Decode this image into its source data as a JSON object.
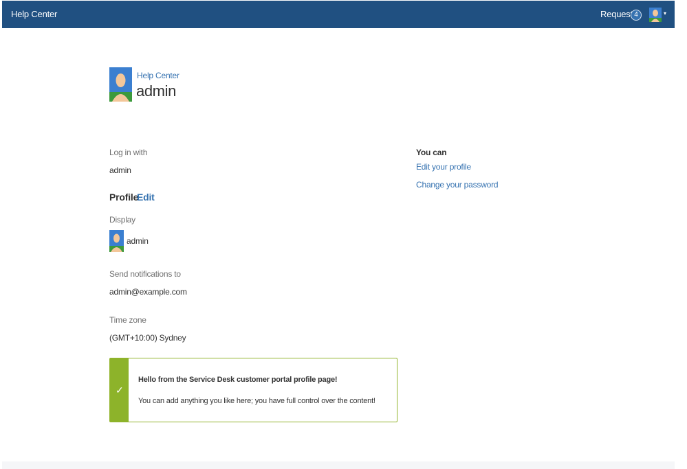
{
  "header": {
    "brand": "Help Center",
    "requests_label": "Requests",
    "requests_count": "4",
    "caret": "▾"
  },
  "breadcrumb": "Help Center",
  "page_title": "admin",
  "login": {
    "label": "Log in with",
    "value": "admin"
  },
  "profile": {
    "heading": "Profile",
    "edit_label": "Edit",
    "display_label": "Display",
    "display_name": "admin",
    "notify_label": "Send notifications to",
    "notify_value": "admin@example.com",
    "timezone_label": "Time zone",
    "timezone_value": "(GMT+10:00) Sydney"
  },
  "side": {
    "heading": "You can",
    "links": [
      "Edit your profile",
      "Change your password"
    ]
  },
  "message": {
    "icon": "✓",
    "title": "Hello from the Service Desk customer portal profile page!",
    "body": "You can add anything you like here; you have full control over the content!"
  },
  "colors": {
    "header_bg": "#205081",
    "link": "#3572b0",
    "success": "#8db32a"
  },
  "icons": {
    "user_avatar": "user-avatar-icon",
    "check": "check-icon",
    "dropdown": "chevron-down-icon"
  }
}
